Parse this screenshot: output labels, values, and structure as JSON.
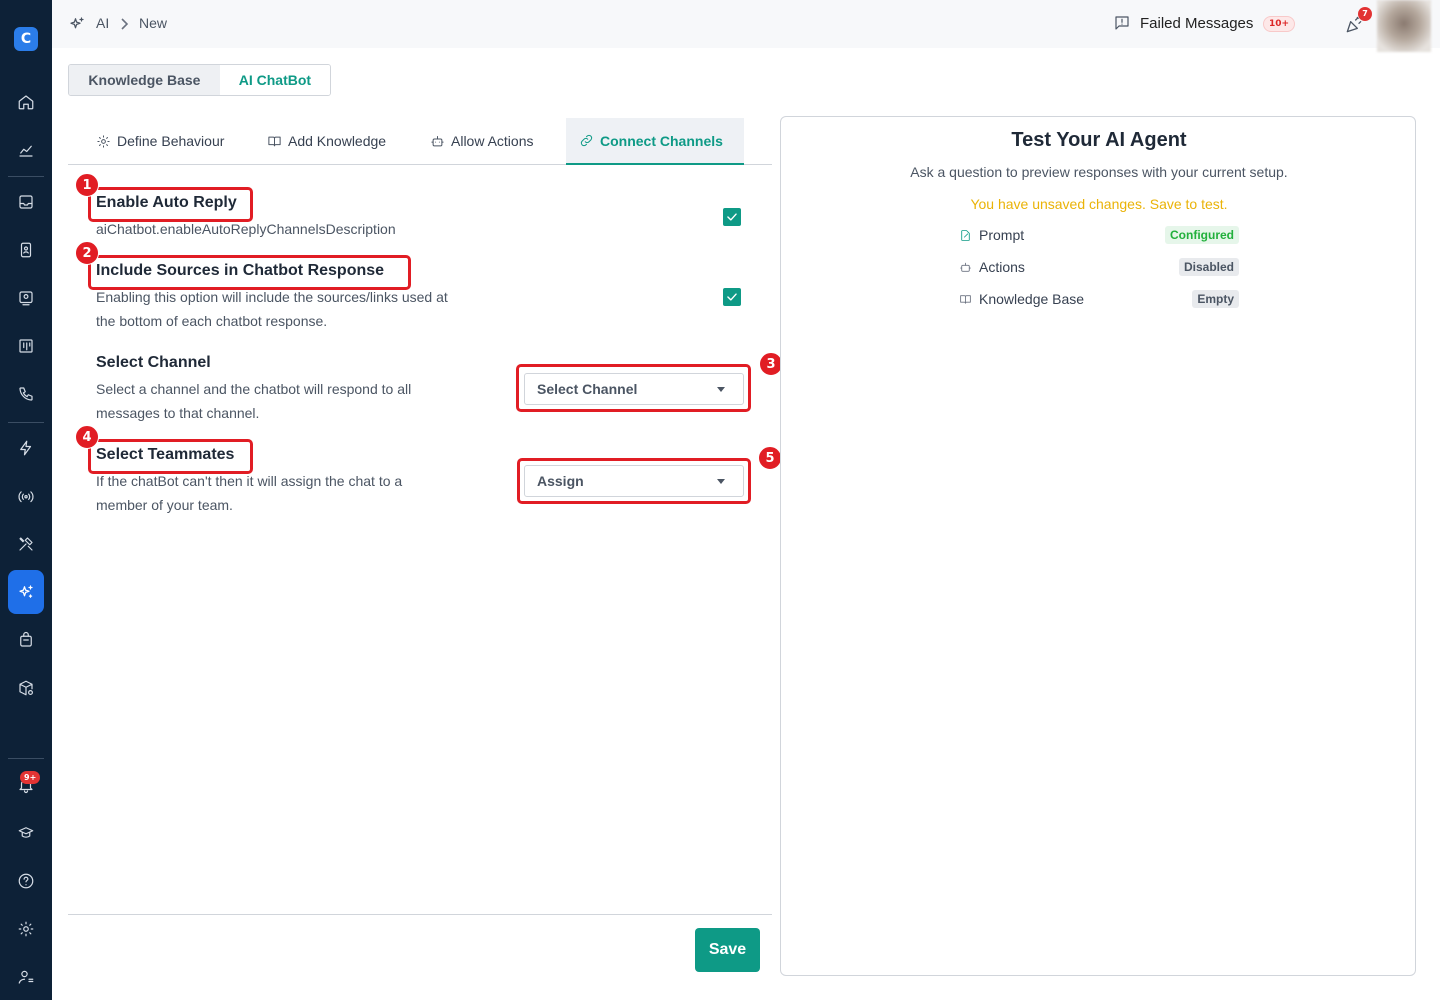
{
  "breadcrumb": {
    "root": "AI",
    "current": "New"
  },
  "header": {
    "failed_messages_label": "Failed Messages",
    "failed_messages_badge": "10+",
    "notifications_badge": "7"
  },
  "sidebar": {
    "logo": "C",
    "notifications_badge": "9+"
  },
  "top_tabs": [
    "Knowledge Base",
    "AI ChatBot"
  ],
  "sub_tabs": [
    "Define Behaviour",
    "Add Knowledge",
    "Allow Actions",
    "Connect Channels"
  ],
  "settings": {
    "auto_reply": {
      "title": "Enable Auto Reply",
      "description": "aiChatbot.enableAutoReplyChannelsDescription",
      "checked": true
    },
    "include_sources": {
      "title": "Include Sources in Chatbot Response",
      "description_line1": "Enabling this option will include the sources/links used at",
      "description_line2": "the bottom of each chatbot response.",
      "checked": true
    },
    "select_channel": {
      "title": "Select Channel",
      "description_line1": "Select a channel and the chatbot will respond to all",
      "description_line2": "messages to that channel.",
      "value": "Select Channel"
    },
    "select_teammates": {
      "title": "Select Teammates",
      "description_line1": "If the chatBot can't then it will assign the chat to a",
      "description_line2": "member of your team.",
      "value": "Assign"
    }
  },
  "annotations": [
    "1",
    "2",
    "3",
    "4",
    "5"
  ],
  "save_label": "Save",
  "test_panel": {
    "title": "Test Your AI Agent",
    "subtitle": "Ask a question to preview responses with your current setup.",
    "warning": "You have unsaved changes. Save to test.",
    "rows": [
      {
        "label": "Prompt",
        "status": "Configured"
      },
      {
        "label": "Actions",
        "status": "Disabled"
      },
      {
        "label": "Knowledge Base",
        "status": "Empty"
      }
    ]
  },
  "colors": {
    "accent": "#0e9a86",
    "sidebar": "#0d2137",
    "highlight": "#e11d24",
    "warning": "#eab308"
  }
}
